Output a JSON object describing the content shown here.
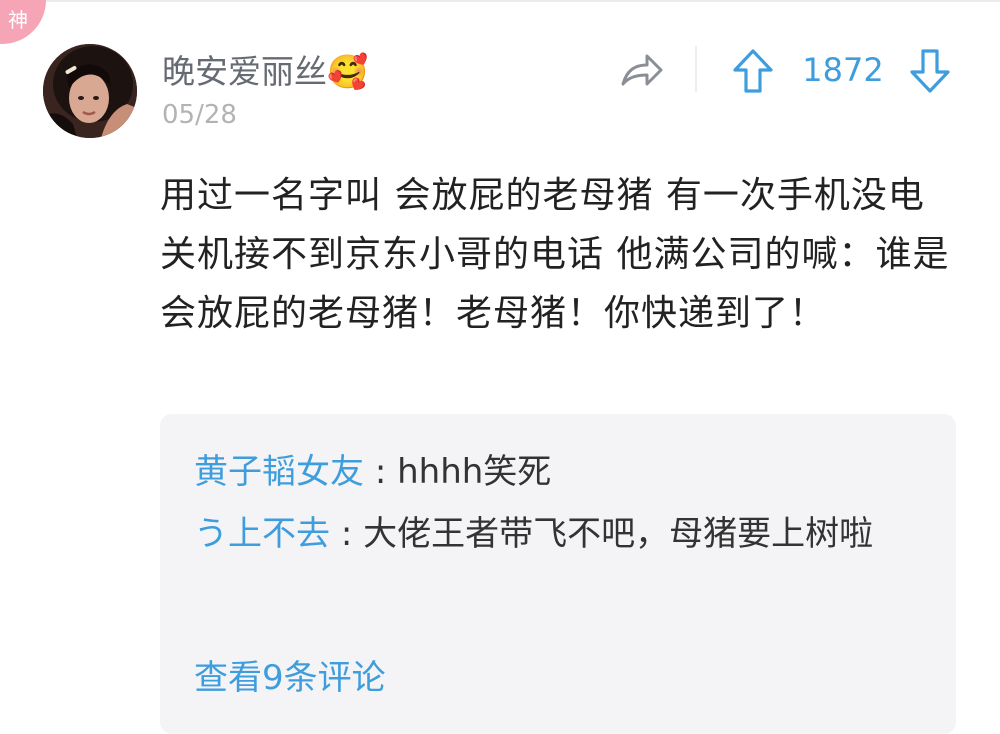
{
  "badge": {
    "label": "神",
    "color": "#f6a5b7"
  },
  "author": {
    "name": "晚安爱丽丝🥰",
    "date": "05/28",
    "avatar_icon": "avatar-photo"
  },
  "actions": {
    "share_icon": "share-icon",
    "upvote_icon": "arrow-up-icon",
    "downvote_icon": "arrow-down-icon",
    "vote_count": "1872"
  },
  "post": {
    "text": "用过一名字叫  会放屁的老母猪 有一次手机没电关机接不到京东小哥的电话 他满公司的喊：谁是会放屁的老母猪！老母猪！你快递到了！"
  },
  "replies": [
    {
      "author": "黄子韬女友",
      "separator": ":",
      "text": "hhhh笑死"
    },
    {
      "author": "う上不去",
      "separator": ":",
      "text": "大佬王者带飞不吧，母猪要上树啦"
    }
  ],
  "view_more": "查看9条评论",
  "colors": {
    "accent": "#3e9ddd",
    "username": "#666b73",
    "date": "#b3b3b3",
    "reply_bg": "#f4f4f7"
  }
}
